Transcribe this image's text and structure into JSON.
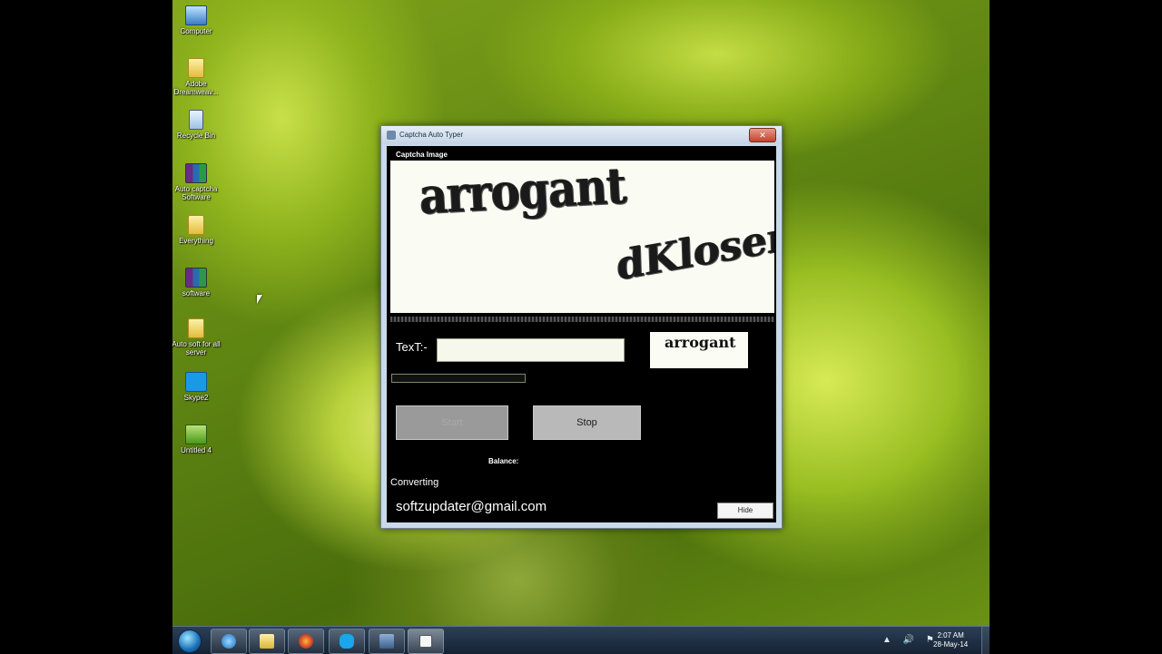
{
  "desktop": {
    "icons": [
      {
        "label": "Computer",
        "icon": "computer-icon"
      },
      {
        "label": "Adobe Dreamweav...",
        "icon": "folder-icon"
      },
      {
        "label": "Recycle Bin",
        "icon": "recycle-bin-icon"
      },
      {
        "label": "Auto captcha Software",
        "icon": "winrar-archive-icon"
      },
      {
        "label": "Everything",
        "icon": "folder-icon"
      },
      {
        "label": "software",
        "icon": "winrar-archive-icon"
      },
      {
        "label": "Auto soft for all server",
        "icon": "folder-icon"
      },
      {
        "label": "Skype2",
        "icon": "skype-icon"
      },
      {
        "label": "Untitled 4",
        "icon": "image-file-icon"
      }
    ]
  },
  "window": {
    "title": "Captcha Auto Typer",
    "close_label": "✕",
    "captcha_label": "Captcha Image",
    "captcha_words": [
      "arrogant",
      "dKlosen"
    ],
    "text_label": "TexT:-",
    "text_value": "",
    "preview_word": "arrogant",
    "progress": 0,
    "start_label": "Start",
    "stop_label": "Stop",
    "balance_label": "Balance:",
    "status_text": "Converting",
    "email": "softzupdater@gmail.com",
    "hide_label": "Hide"
  },
  "taskbar": {
    "pinned": [
      {
        "name": "internet-explorer",
        "icon": "ie-icon"
      },
      {
        "name": "explorer",
        "icon": "folder-icon"
      },
      {
        "name": "firefox",
        "icon": "firefox-icon"
      },
      {
        "name": "skype",
        "icon": "skype-icon"
      },
      {
        "name": "save",
        "icon": "floppy-icon"
      },
      {
        "name": "window",
        "icon": "window-icon"
      }
    ],
    "tray": "▲ 🔊 ⚑",
    "time": "2:07 AM",
    "date": "28-May-14"
  }
}
